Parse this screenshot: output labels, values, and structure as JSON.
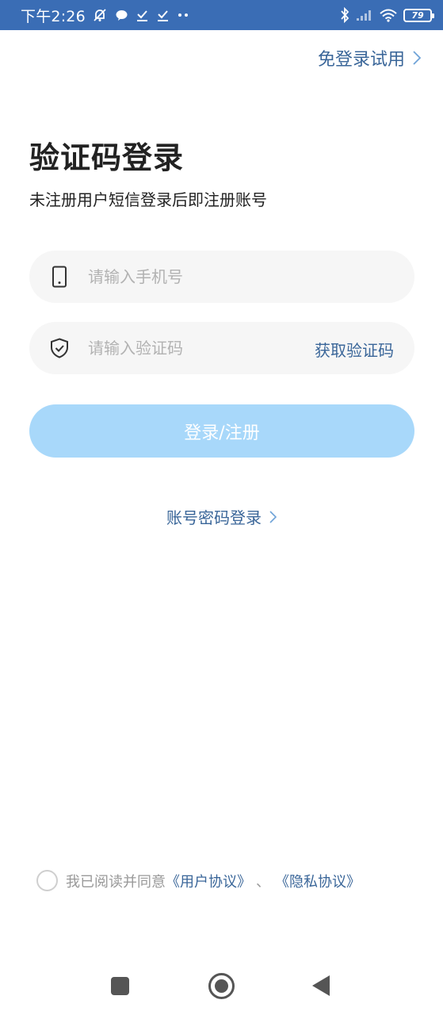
{
  "status_bar": {
    "time": "下午2:26",
    "battery": "79",
    "icons_left": [
      "mute-bell-icon",
      "chat-bubble-icon",
      "download-check-icon",
      "download-check-icon",
      "more-dots-icon"
    ],
    "icons_right": [
      "bluetooth-icon",
      "signal-icon",
      "wifi-icon",
      "battery-icon"
    ]
  },
  "header": {
    "trial_link": "免登录试用"
  },
  "login": {
    "title": "验证码登录",
    "subtitle": "未注册用户短信登录后即注册账号",
    "phone_placeholder": "请输入手机号",
    "code_placeholder": "请输入验证码",
    "get_code": "获取验证码",
    "submit": "登录/注册",
    "password_login": "账号密码登录"
  },
  "agreement": {
    "prefix": "我已阅读并同意",
    "user_agreement": "《用户协议》",
    "separator": "、",
    "privacy_policy": "《隐私协议》",
    "checked": false
  },
  "colors": {
    "status_bar": "#3a6db5",
    "link": "#3a6699",
    "button_disabled": "#a8d8fa",
    "input_bg": "#f6f6f6"
  }
}
